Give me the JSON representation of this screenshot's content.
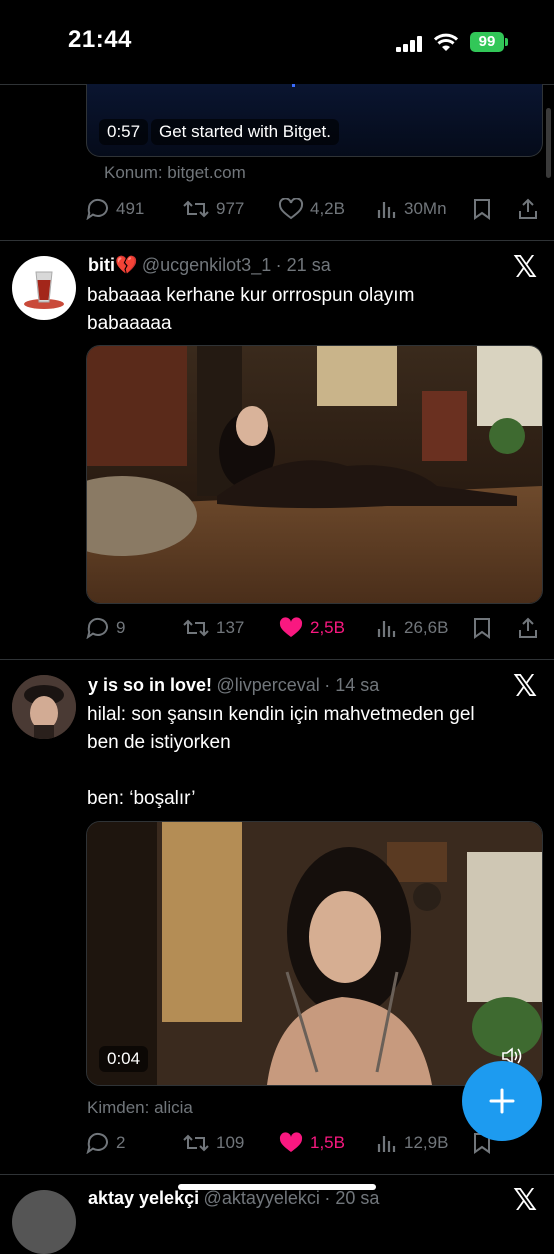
{
  "status_bar": {
    "time": "21:44",
    "battery": "99"
  },
  "ad": {
    "video_time": "0:57",
    "caption": "Get started with Bitget.",
    "location": "Konum: bitget.com",
    "replies": "491",
    "reposts": "977",
    "likes": "4,2B",
    "views": "30Mn"
  },
  "tweets": [
    {
      "name": "biti💔",
      "handle": "@ucgenkilot3_1",
      "time": "· 21 sa",
      "text": "babaaaa kerhane kur orrrospun olayım\nbabaaaaa",
      "replies": "9",
      "reposts": "137",
      "likes": "2,5B",
      "views": "26,6B"
    },
    {
      "name": "y is so in love!",
      "handle": "@livperceval",
      "time": "· 14 sa",
      "text": "hilal: son şansın kendin için mahvetmeden gel\nben de istiyorken\n\nben: ‘boşalır’",
      "video_time": "0:04",
      "source": "Kimden: alicia",
      "replies": "2",
      "reposts": "109",
      "likes": "1,5B",
      "views": "12,9B"
    },
    {
      "name": "aktay yelekçi",
      "handle": "@aktayyelekci",
      "time": "· 20 sa"
    }
  ],
  "colors": {
    "accent": "#1d9bf0",
    "like": "#f91880",
    "muted": "#71767b",
    "battery": "#32c758"
  }
}
